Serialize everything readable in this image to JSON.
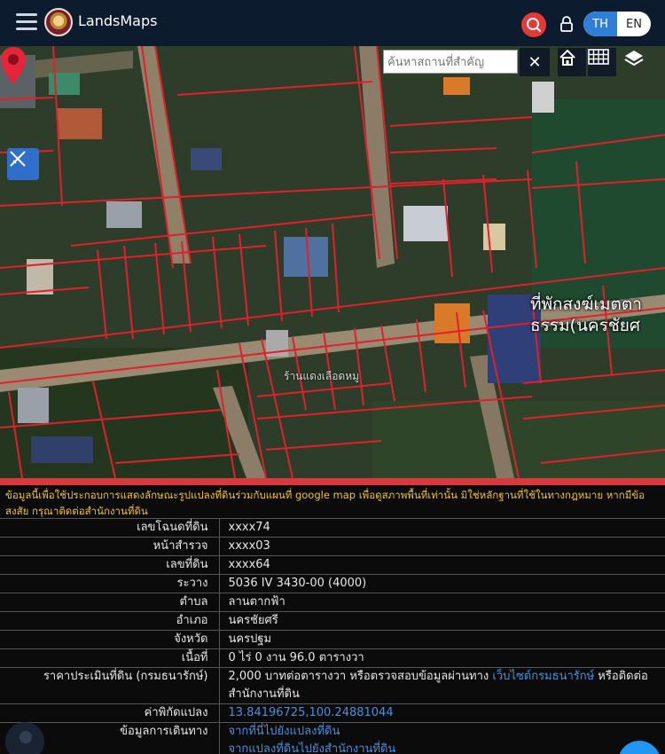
{
  "header": {
    "brand": "LandsMaps",
    "lang_th": "TH",
    "lang_en": "EN",
    "colors": {
      "bar": "#0d1b2e",
      "search": "#e53935",
      "lang_active": "#2f7fd8"
    }
  },
  "map": {
    "search_placeholder": "ค้นหาสถานที่สำคัญ",
    "clear_icon": "close-icon",
    "place_label_line1": "ที่พักสงฆ์เมตตา",
    "place_label_line2": "ธรรม(นครชัยศ",
    "parcel_label": "ร้านแดงเลือดหมู",
    "boundary_color": "#e0202a"
  },
  "disclaimer": "ข้อมูลนี้เพื่อใช้ประกอบการแสดงลักษณะรูปแปลงที่ดินร่วมกับแผนที่ google map เพื่อดูสภาพพื้นที่เท่านั้น มิใช่หลักฐานที่ใช้ในทางกฎหมาย หากมีข้อสงสัย กรุณาติดต่อสำนักงานที่ดิน",
  "details": {
    "rows": [
      {
        "label": "เลขโฉนดที่ดิน",
        "value": "xxxx74"
      },
      {
        "label": "หน้าสำรวจ",
        "value": "xxxx03"
      },
      {
        "label": "เลขที่ดิน",
        "value": "xxxx64"
      },
      {
        "label": "ระวาง",
        "value": "5036 IV 3430-00 (4000)"
      },
      {
        "label": "ตำบล",
        "value": "ลานตากฟ้า"
      },
      {
        "label": "อำเภอ",
        "value": "นครชัยศรี"
      },
      {
        "label": "จังหวัด",
        "value": "นครปฐม"
      },
      {
        "label": "เนื้อที่",
        "value": "0 ไร่ 0 งาน 96.0 ตารางวา"
      }
    ],
    "price_label": "ราคาประเมินที่ดิน (กรมธนารักษ์)",
    "price_value_pre": "2,000 บาทต่อตารางวา หรือตรวจสอบข้อมูลผ่านทาง ",
    "price_link": "เว็บไซต์กรมธนารักษ์",
    "price_value_post": " หรือติดต่อสำนักงานที่ดิน",
    "coord_label": "ค่าพิกัดแปลง",
    "coord_value": "13.84196725,100.24881044",
    "travel_label": "ข้อมูลการเดินทาง",
    "travel_link1": "จากที่นี่ไปยังแปลงที่ดิน",
    "travel_link2": "จากแปลงที่ดินไปยังสำนักงานที่ดิน"
  }
}
